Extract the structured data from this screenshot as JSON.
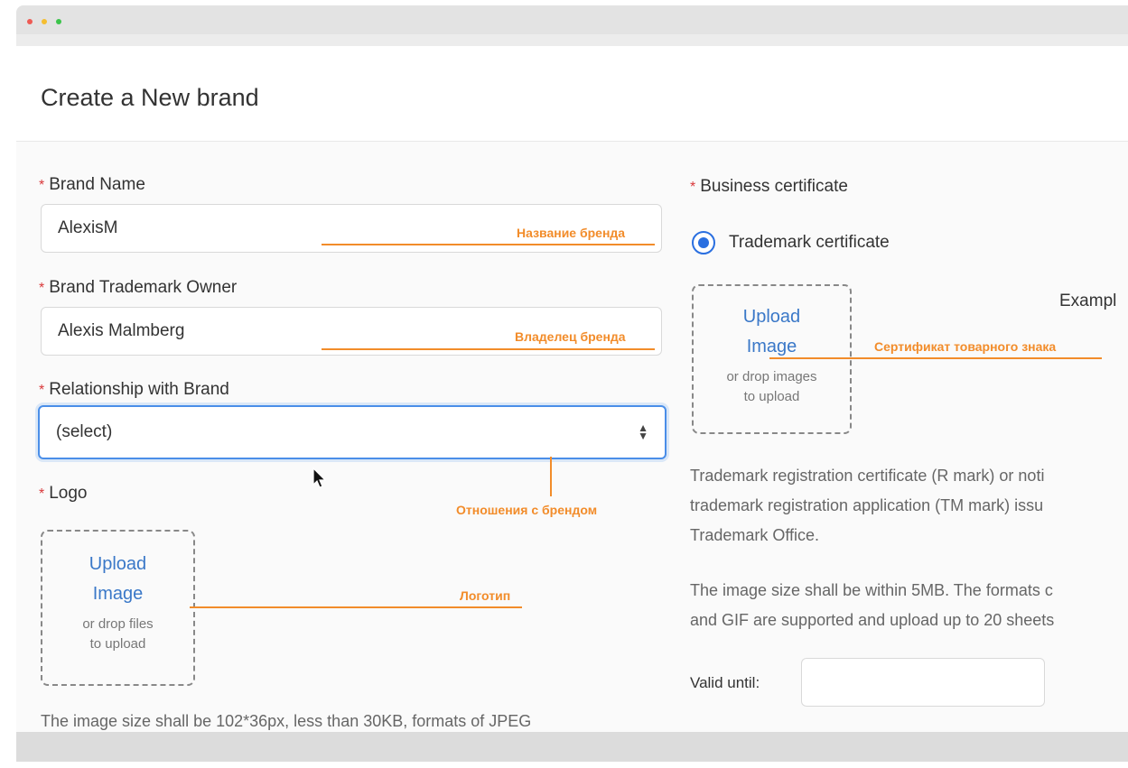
{
  "page": {
    "title": "Create a New brand"
  },
  "form": {
    "brand_name": {
      "label": "Brand Name",
      "value": "AlexisM"
    },
    "trademark_owner": {
      "label": "Brand Trademark Owner",
      "value": "Alexis Malmberg"
    },
    "relationship": {
      "label": "Relationship with Brand",
      "selected": "(select)"
    },
    "logo": {
      "label": "Logo",
      "upload_line1": "Upload",
      "upload_line2": "Image",
      "drop_line1": "or drop files",
      "drop_line2": "to upload",
      "help": "The image size shall be 102*36px, less than 30KB, formats of JPEG"
    },
    "business_certificate": {
      "label": "Business certificate",
      "radio_label": "Trademark certificate",
      "upload_line1": "Upload",
      "upload_line2": "Image",
      "drop_line1": "or drop images",
      "drop_line2": "to upload",
      "example_label": "Exampl",
      "help_line1": "Trademark registration certificate (R mark) or noti",
      "help_line2": "trademark registration application (TM mark) issu",
      "help_line3": "Trademark Office.",
      "help_line4": "The image size shall be within 5MB. The formats c",
      "help_line5": "and GIF are supported and upload up to 20 sheets",
      "valid_until_label": "Valid until:",
      "valid_until_value": ""
    }
  },
  "annotations": {
    "brand_name": "Название бренда",
    "owner": "Владелец бренда",
    "relationship": "Отношения с брендом",
    "logo": "Логотип",
    "certificate": "Сертификат товарного знака"
  },
  "colors": {
    "annotation": "#f28c2a",
    "required": "#d9383a",
    "link": "#3a78c8",
    "focus": "#4a8ee8"
  }
}
